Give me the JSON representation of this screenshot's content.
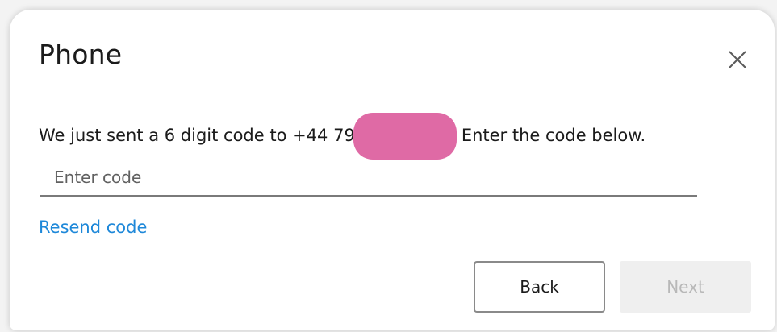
{
  "dialog": {
    "title": "Phone",
    "close_icon": "close-icon",
    "message_before": "We just sent a 6 digit code to +44 79",
    "message_after": "Enter the code below.",
    "redaction_color": "#df6aa5",
    "code_input": {
      "value": "",
      "placeholder": "Enter code"
    },
    "resend_label": "Resend code",
    "link_color": "#1e88d9",
    "back_label": "Back",
    "next_label": "Next"
  }
}
